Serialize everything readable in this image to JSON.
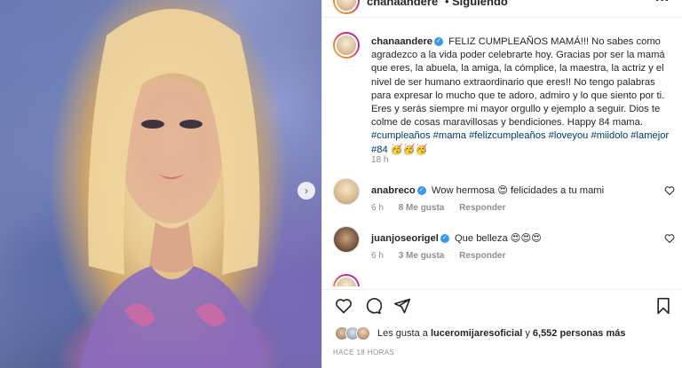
{
  "post": {
    "username": "chanaandere",
    "follow_status": "Siguiendo",
    "separator": "•"
  },
  "caption": {
    "username": "chanaandere",
    "text": "FELIZ CUMPLEAÑOS MAMÁ!!! No sabes como agradezco a la vida poder celebrarte hoy. Gracias por ser la mamá que eres, la abuela, la amiga, la cómplice, la maestra, la actriz y el nivel de ser humano extraordinario que eres!! No tengo palabras para expresar lo mucho que te adoro, admiro y lo que siento por ti. Eres y serás siempre mi mayor orgullo y ejemplo a seguir. Dios te colme de cosas maravillosas y bendiciones. Happy 84 mama.",
    "hashtags": "#cumpleaños #mama #felizcumpleaños #loveyou #miidolo #lamejor #84",
    "emojis": "🥳🥳🥳",
    "time": "18 h"
  },
  "comments": [
    {
      "username": "anabreco",
      "text": "Wow hermosa 😍 felicidades a tu mami",
      "time": "6 h",
      "likes": "8 Me gusta",
      "reply_label": "Responder"
    },
    {
      "username": "juanjoseorigel",
      "text": "Que belleza 😍😍😍",
      "time": "6 h",
      "likes": "3 Me gusta",
      "reply_label": "Responder"
    }
  ],
  "likes": {
    "prefix": "Les gusta a",
    "user": "luceromijaresoficial",
    "connector": "y",
    "others": "6,552 personas más"
  },
  "timestamp": "HACE 18 HORAS",
  "icons": {
    "like": "heart-icon",
    "comment": "comment-icon",
    "share": "share-icon",
    "save": "bookmark-icon",
    "more": "more-options-icon",
    "next": "chevron-right-icon",
    "verified": "verified-badge-icon"
  },
  "colors": {
    "verified": "#3897f0",
    "hashtag": "#00376b",
    "muted": "#8e8e8e"
  }
}
